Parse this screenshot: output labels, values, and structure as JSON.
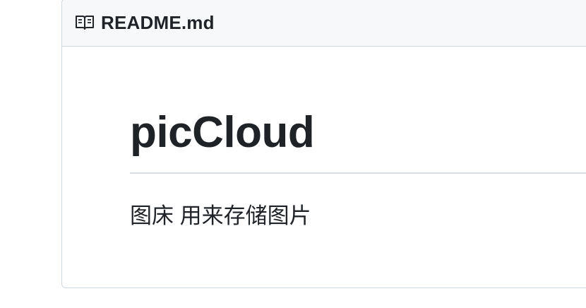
{
  "readme": {
    "header": {
      "icon": "book-icon",
      "file_name": "README.md"
    },
    "title": "picCloud",
    "description": "图床 用来存储图片"
  },
  "colors": {
    "header_background": "#f6f8fa",
    "border": "#d0d7de",
    "text": "#1f2328"
  }
}
